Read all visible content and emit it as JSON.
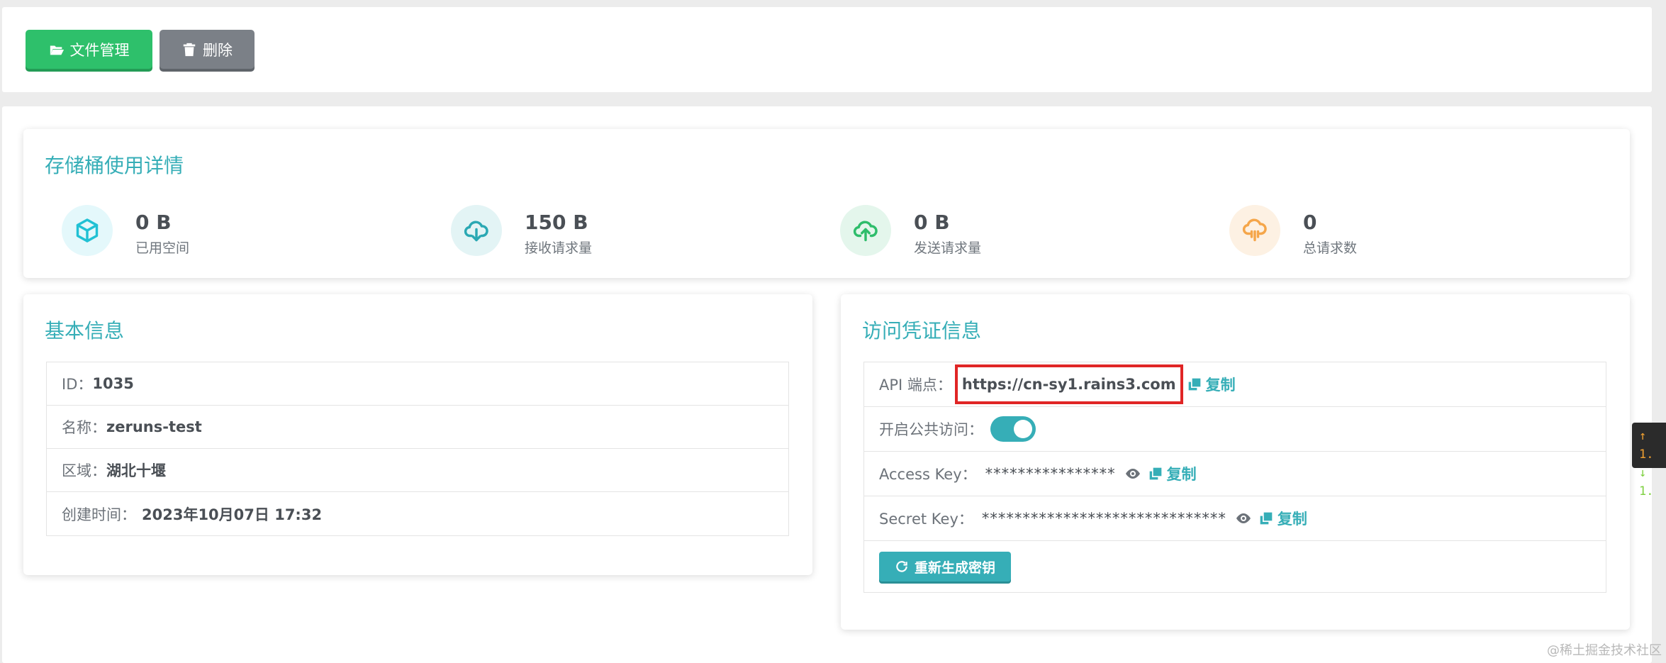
{
  "toolbar": {
    "file_manage_label": "文件管理",
    "delete_label": "删除"
  },
  "usage": {
    "title": "存储桶使用详情",
    "stats": [
      {
        "value": "0 B",
        "label": "已用空间",
        "icon": "cube-icon",
        "color": "#20c1d4"
      },
      {
        "value": "150 B",
        "label": "接收请求量",
        "icon": "cloud-download-icon",
        "color": "#2aa8b3"
      },
      {
        "value": "0 B",
        "label": "发送请求量",
        "icon": "cloud-upload-icon",
        "color": "#2ebd6b"
      },
      {
        "value": "0",
        "label": "总请求数",
        "icon": "cloud-rain-icon",
        "color": "#f5a64a"
      }
    ]
  },
  "basic": {
    "title": "基本信息",
    "rows": [
      {
        "label": "ID：",
        "value": "1035"
      },
      {
        "label": "名称：",
        "value": "zeruns-test"
      },
      {
        "label": "区域：",
        "value": "湖北十堰"
      },
      {
        "label": "创建时间：",
        "value": "2023年10月07日 17:32"
      }
    ]
  },
  "cred": {
    "title": "访问凭证信息",
    "endpoint_label": "API 端点：",
    "endpoint_value": "https://cn-sy1.rains3.com",
    "copy_label": "复制",
    "public_label": "开启公共访问：",
    "public_enabled": true,
    "access_key_label": "Access Key：",
    "access_key_masked": "****************",
    "secret_key_label": "Secret Key：",
    "secret_key_masked": "******************************",
    "regen_label": "重新生成密钥"
  },
  "net_widget": {
    "up": "↑ 1.",
    "down": "↓ 1."
  },
  "watermark": "@稀土掘金技术社区",
  "colors": {
    "accent": "#36aeb7",
    "green_button": "#2ec06b",
    "grey_button": "#7b8087",
    "highlight_box": "#e02525"
  }
}
